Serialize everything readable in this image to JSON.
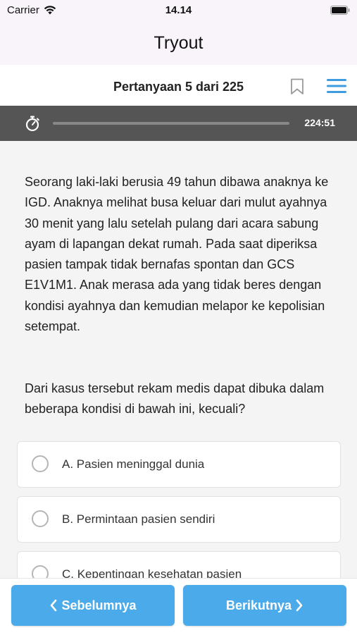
{
  "status_bar": {
    "carrier": "Carrier",
    "time": "14.14"
  },
  "nav": {
    "title": "Tryout"
  },
  "question_header": {
    "count_label": "Pertanyaan 5 dari 225"
  },
  "timer": {
    "remaining": "224:51",
    "progress_fraction": 0.0
  },
  "question": {
    "paragraphs": [
      "Seorang laki-laki berusia 49 tahun dibawa anaknya ke IGD. Anaknya melihat busa keluar dari mulut ayahnya 30 menit yang lalu setelah pulang dari acara sabung ayam di lapangan dekat rumah. Pada saat diperiksa pasien tampak tidak bernafas spontan dan GCS E1V1M1. Anak merasa ada yang tidak beres dengan kondisi ayahnya dan kemudian melapor ke kepolisian setempat.",
      "Dari kasus tersebut rekam medis dapat dibuka dalam beberapa kondisi di bawah ini, kecuali?"
    ]
  },
  "options": [
    {
      "label": "A. Pasien meninggal dunia"
    },
    {
      "label": "B. Permintaan pasien sendiri"
    },
    {
      "label": "C. Kepentingan kesehatan pasien"
    }
  ],
  "footer": {
    "prev_label": "Sebelumnya",
    "next_label": "Berikutnya"
  },
  "colors": {
    "accent": "#4aaaea",
    "menu_icon": "#3d9be0",
    "timer_bar": "#555555"
  },
  "icons": [
    "wifi-icon",
    "battery-icon",
    "bookmark-icon",
    "menu-icon",
    "stopwatch-icon",
    "chevron-left-icon",
    "chevron-right-icon"
  ]
}
